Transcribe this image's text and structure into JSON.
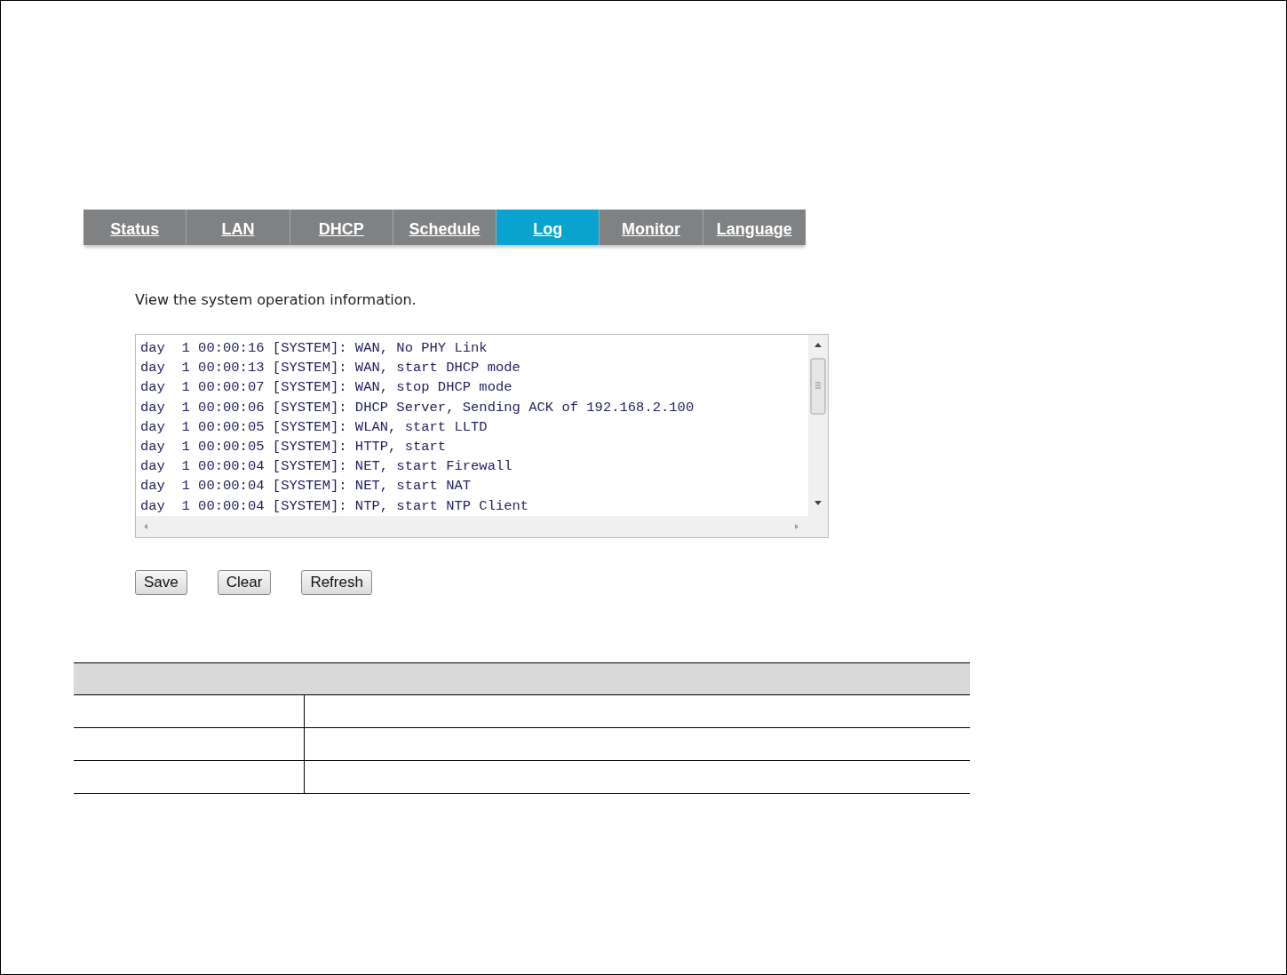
{
  "tabs": [
    {
      "label": "Status",
      "selected": false
    },
    {
      "label": "LAN",
      "selected": false
    },
    {
      "label": "DHCP",
      "selected": false
    },
    {
      "label": "Schedule",
      "selected": false
    },
    {
      "label": "Log",
      "selected": true
    },
    {
      "label": "Monitor",
      "selected": false
    },
    {
      "label": "Language",
      "selected": false
    }
  ],
  "description": "View the system operation information.",
  "log_lines": [
    "day  1 00:00:16 [SYSTEM]: WAN, No PHY Link",
    "day  1 00:00:13 [SYSTEM]: WAN, start DHCP mode",
    "day  1 00:00:07 [SYSTEM]: WAN, stop DHCP mode",
    "day  1 00:00:06 [SYSTEM]: DHCP Server, Sending ACK of 192.168.2.100",
    "day  1 00:00:05 [SYSTEM]: WLAN, start LLTD",
    "day  1 00:00:05 [SYSTEM]: HTTP, start",
    "day  1 00:00:04 [SYSTEM]: NET, start Firewall",
    "day  1 00:00:04 [SYSTEM]: NET, start NAT",
    "day  1 00:00:04 [SYSTEM]: NTP, start NTP Client"
  ],
  "buttons": [
    "Save",
    "Clear",
    "Refresh"
  ]
}
